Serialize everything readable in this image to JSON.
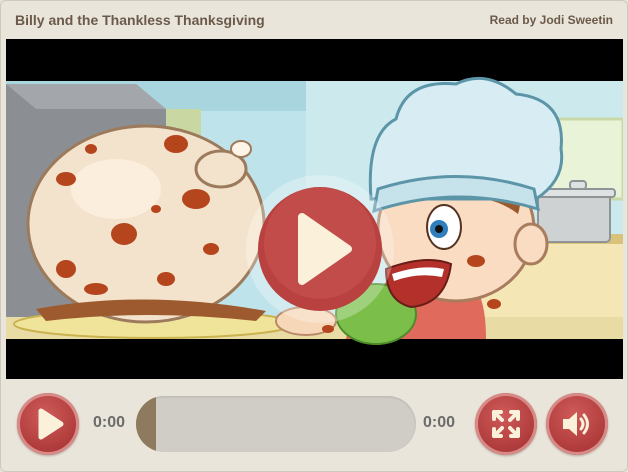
{
  "header": {
    "title": "Billy and the Thankless Thanksgiving",
    "narrator": "Read by Jodi Sweetin"
  },
  "video": {
    "overlay_icon": "play-icon"
  },
  "controls": {
    "play_icon": "play-icon",
    "current_time": "0:00",
    "duration": "0:00",
    "progress": 0,
    "fullscreen_icon": "fullscreen-icon",
    "volume_icon": "volume-icon"
  },
  "colors": {
    "button_red": "#b23e3e",
    "progress_track": "#d0cdc7",
    "progress_fill": "#8e7a5e",
    "header_text": "#6b5a49"
  }
}
